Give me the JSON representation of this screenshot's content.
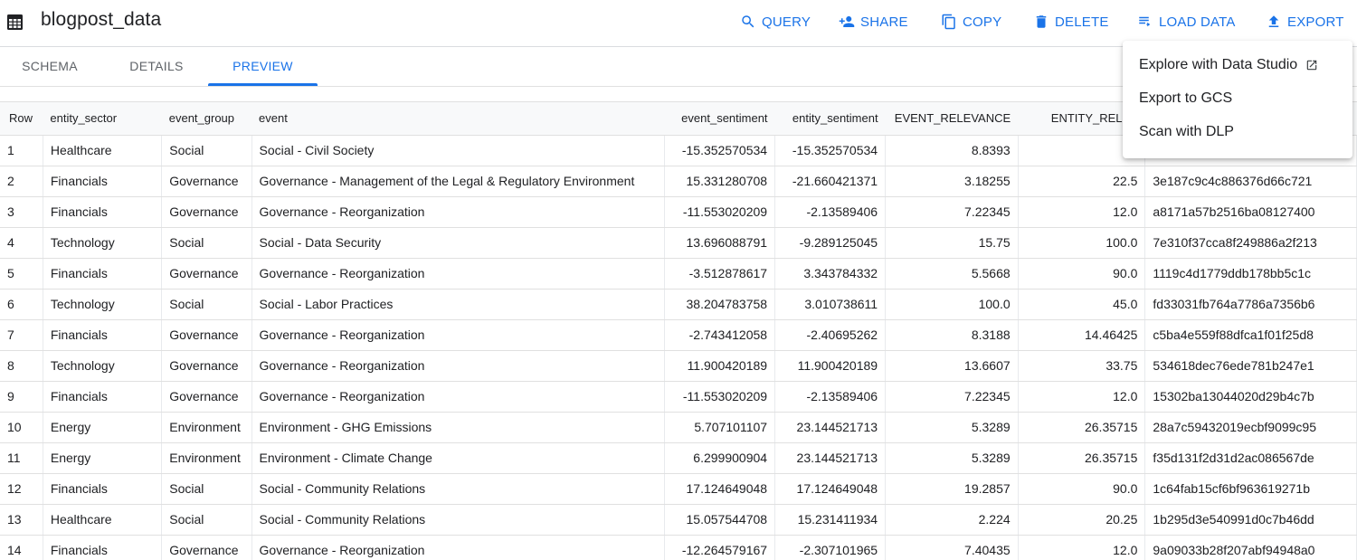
{
  "header": {
    "title": "blogpost_data",
    "title_icon": "table-icon",
    "accent_color": "#1a73e8",
    "actions": [
      {
        "label": "QUERY",
        "icon": "search-icon"
      },
      {
        "label": "SHARE",
        "icon": "person-add-icon"
      },
      {
        "label": "COPY",
        "icon": "copy-icon"
      },
      {
        "label": "DELETE",
        "icon": "trash-icon"
      },
      {
        "label": "LOAD DATA",
        "icon": "load-data-icon"
      },
      {
        "label": "EXPORT",
        "icon": "upload-icon"
      }
    ]
  },
  "tabs": [
    {
      "label": "SCHEMA",
      "active": false
    },
    {
      "label": "DETAILS",
      "active": false
    },
    {
      "label": "PREVIEW",
      "active": true
    }
  ],
  "export_menu": {
    "items": [
      {
        "label": "Explore with Data Studio",
        "icon": "open-in-new-icon"
      },
      {
        "label": "Export to GCS"
      },
      {
        "label": "Scan with DLP"
      }
    ]
  },
  "table": {
    "columns": [
      "Row",
      "entity_sector",
      "event_group",
      "event",
      "event_sentiment",
      "entity_sentiment",
      "EVENT_RELEVANCE",
      "ENTITY_RELEV",
      ""
    ],
    "rows": [
      [
        "1",
        "Healthcare",
        "Social",
        "Social - Civil Society",
        "-15.352570534",
        "-15.352570534",
        "8.8393",
        "",
        ""
      ],
      [
        "2",
        "Financials",
        "Governance",
        "Governance - Management of the Legal & Regulatory Environment",
        "15.331280708",
        "-21.660421371",
        "3.18255",
        "22.5",
        "3e187c9c4c886376d66c721"
      ],
      [
        "3",
        "Financials",
        "Governance",
        "Governance - Reorganization",
        "-11.553020209",
        "-2.13589406",
        "7.22345",
        "12.0",
        "a8171a57b2516ba08127400"
      ],
      [
        "4",
        "Technology",
        "Social",
        "Social - Data Security",
        "13.696088791",
        "-9.289125045",
        "15.75",
        "100.0",
        "7e310f37cca8f249886a2f213"
      ],
      [
        "5",
        "Financials",
        "Governance",
        "Governance - Reorganization",
        "-3.512878617",
        "3.343784332",
        "5.5668",
        "90.0",
        "1119c4d1779ddb178bb5c1c"
      ],
      [
        "6",
        "Technology",
        "Social",
        "Social - Labor Practices",
        "38.204783758",
        "3.010738611",
        "100.0",
        "45.0",
        "fd33031fb764a7786a7356b6"
      ],
      [
        "7",
        "Financials",
        "Governance",
        "Governance - Reorganization",
        "-2.743412058",
        "-2.40695262",
        "8.3188",
        "14.46425",
        "c5ba4e559f88dfca1f01f25d8"
      ],
      [
        "8",
        "Technology",
        "Governance",
        "Governance - Reorganization",
        "11.900420189",
        "11.900420189",
        "13.6607",
        "33.75",
        "534618dec76ede781b247e1"
      ],
      [
        "9",
        "Financials",
        "Governance",
        "Governance - Reorganization",
        "-11.553020209",
        "-2.13589406",
        "7.22345",
        "12.0",
        "15302ba13044020d29b4c7b"
      ],
      [
        "10",
        "Energy",
        "Environment",
        "Environment - GHG Emissions",
        "5.707101107",
        "23.144521713",
        "5.3289",
        "26.35715",
        "28a7c59432019ecbf9099c95"
      ],
      [
        "11",
        "Energy",
        "Environment",
        "Environment - Climate Change",
        "6.299900904",
        "23.144521713",
        "5.3289",
        "26.35715",
        "f35d131f2d31d2ac086567de"
      ],
      [
        "12",
        "Financials",
        "Social",
        "Social - Community Relations",
        "17.124649048",
        "17.124649048",
        "19.2857",
        "90.0",
        "1c64fab15cf6bf963619271b"
      ],
      [
        "13",
        "Healthcare",
        "Social",
        "Social - Community Relations",
        "15.057544708",
        "15.231411934",
        "2.224",
        "20.25",
        "1b295d3e540991d0c7b46dd"
      ],
      [
        "14",
        "Financials",
        "Governance",
        "Governance - Reorganization",
        "-12.264579167",
        "-2.307101965",
        "7.40435",
        "12.0",
        "9a09033b28f207abf94948a0"
      ]
    ]
  }
}
